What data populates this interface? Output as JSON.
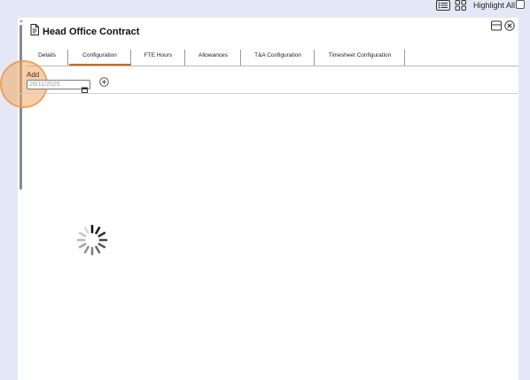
{
  "topbar": {
    "list_view_icon": "list-view-icon",
    "grid_view_icon": "grid-view-icon",
    "highlight_all_label": "Highlight All",
    "highlight_all_checked": false
  },
  "panel": {
    "title": "Head Office Contract",
    "title_icon": "document-icon",
    "window_icon": "window-restore-icon",
    "close_icon": "close-circle-icon"
  },
  "tabs": [
    {
      "label": "Details",
      "active": false
    },
    {
      "label": "Configuration",
      "active": true
    },
    {
      "label": "FTE Hours",
      "active": false
    },
    {
      "label": "Allowances",
      "active": false
    },
    {
      "label": "T&A Configuration",
      "active": false
    },
    {
      "label": "Timesheet Configuration",
      "active": false
    }
  ],
  "add_section": {
    "label": "Add",
    "date_value": "26/11/2025",
    "calendar_icon": "calendar-icon",
    "add_icon": "add-circle-icon"
  },
  "loading": {
    "spinner_icon": "loading-spinner-icon"
  },
  "colors": {
    "accent": "#c46a24",
    "background": "#e4e8f6",
    "panel": "#ffffff",
    "focus_highlight": "#f0a860"
  }
}
